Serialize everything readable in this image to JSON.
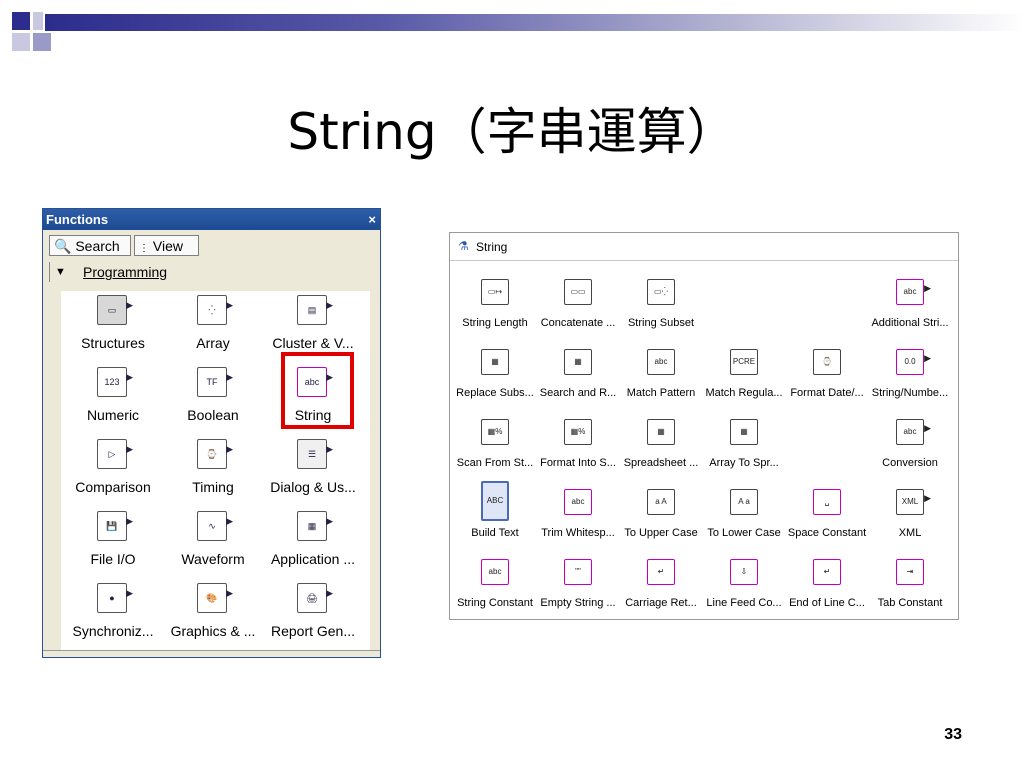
{
  "slide": {
    "title": "String（字串運算）",
    "page_number": "33",
    "colors": {
      "bar_dark": "#2c2c8c",
      "highlight": "#e00000"
    }
  },
  "functions_palette": {
    "title": "Functions",
    "close_icon": "×",
    "search_label": "Search",
    "view_label": "View",
    "category": "Programming",
    "items": [
      {
        "label": "Structures",
        "icon": "structures-icon"
      },
      {
        "label": "Array",
        "icon": "array-icon"
      },
      {
        "label": "Cluster & V...",
        "icon": "cluster-icon"
      },
      {
        "label": "Numeric",
        "icon": "numeric-icon"
      },
      {
        "label": "Boolean",
        "icon": "boolean-icon"
      },
      {
        "label": "String",
        "icon": "string-icon",
        "highlighted": true
      },
      {
        "label": "Comparison",
        "icon": "comparison-icon"
      },
      {
        "label": "Timing",
        "icon": "timing-icon"
      },
      {
        "label": "Dialog & Us...",
        "icon": "dialog-icon"
      },
      {
        "label": "File I/O",
        "icon": "file-io-icon"
      },
      {
        "label": "Waveform",
        "icon": "waveform-icon"
      },
      {
        "label": "Application ...",
        "icon": "application-icon"
      },
      {
        "label": "Synchroniz...",
        "icon": "synchronization-icon"
      },
      {
        "label": "Graphics & ...",
        "icon": "graphics-icon"
      },
      {
        "label": "Report Gen...",
        "icon": "report-icon"
      }
    ]
  },
  "string_palette": {
    "title": "String",
    "items": [
      {
        "label": "String Length"
      },
      {
        "label": "Concatenate ..."
      },
      {
        "label": "String Subset"
      },
      {
        "label": ""
      },
      {
        "label": ""
      },
      {
        "label": "Additional Stri..."
      },
      {
        "label": "Replace Subs..."
      },
      {
        "label": "Search and R..."
      },
      {
        "label": "Match Pattern"
      },
      {
        "label": "Match Regula..."
      },
      {
        "label": "Format Date/..."
      },
      {
        "label": "String/Numbe..."
      },
      {
        "label": "Scan From St..."
      },
      {
        "label": "Format Into S..."
      },
      {
        "label": "Spreadsheet ..."
      },
      {
        "label": "Array To Spr..."
      },
      {
        "label": ""
      },
      {
        "label": "Conversion"
      },
      {
        "label": "Build Text"
      },
      {
        "label": "Trim Whitesp..."
      },
      {
        "label": "To Upper Case"
      },
      {
        "label": "To Lower Case"
      },
      {
        "label": "Space Constant"
      },
      {
        "label": "XML"
      },
      {
        "label": "String Constant"
      },
      {
        "label": "Empty String ..."
      },
      {
        "label": "Carriage Ret..."
      },
      {
        "label": "Line Feed Co..."
      },
      {
        "label": "End of Line C..."
      },
      {
        "label": "Tab Constant"
      }
    ]
  }
}
